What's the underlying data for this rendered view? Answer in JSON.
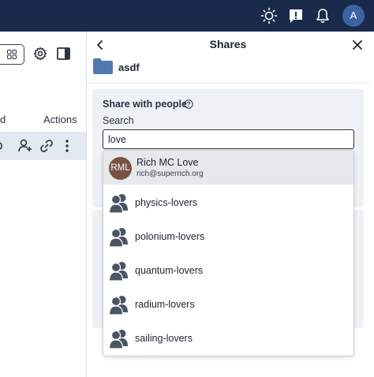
{
  "topbar": {
    "avatar_initial": "A"
  },
  "left_pane": {
    "header_col1": "d",
    "header_actions": "Actions"
  },
  "panel": {
    "title": "Shares",
    "folder_name": "asdf",
    "share_title": "Share with people",
    "search_label": "Search",
    "search_value": "love"
  },
  "results": {
    "user": {
      "initials": "RML",
      "name": "Rich MC Love",
      "email": "rich@superrich.org"
    },
    "groups": [
      "physics-lovers",
      "polonium-lovers",
      "quantum-lovers",
      "radium-lovers",
      "sailing-lovers"
    ]
  },
  "colors": {
    "topbar": "#1a2a4a",
    "avatar_top": "#3d63a3",
    "user_avatar": "#7a5142",
    "folder": "#5278ad",
    "group_icon": "#4a5464"
  }
}
